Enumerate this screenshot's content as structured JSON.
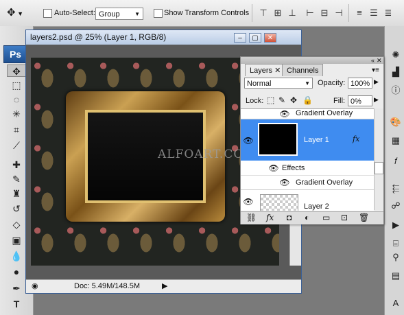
{
  "options_bar": {
    "auto_select_label": "Auto-Select:",
    "auto_select_value": "Group",
    "show_transform_label": "Show Transform Controls",
    "move_tool_icon": "move-icon"
  },
  "toolbox": {
    "logo": "Ps",
    "tools": [
      "move-icon",
      "marquee-icon",
      "lasso-icon",
      "magic-wand-icon",
      "crop-icon",
      "slice-icon",
      "healing-icon",
      "brush-icon",
      "clone-stamp-icon",
      "history-brush-icon",
      "eraser-icon",
      "gradient-icon",
      "blur-icon",
      "dodge-icon",
      "pen-icon",
      "type-icon"
    ]
  },
  "document": {
    "title": "layers2.psd @ 25% (Layer 1, RGB/8)",
    "status": "Doc: 5.49M/148.5M",
    "watermark": "ALFOART.COM"
  },
  "layers_panel": {
    "tabs": [
      "Layers",
      "Channels"
    ],
    "blend_mode": "Normal",
    "opacity_label": "Opacity:",
    "opacity_value": "100%",
    "lock_label": "Lock:",
    "fill_label": "Fill:",
    "fill_value": "0%",
    "rows": {
      "prev_gradient": "Gradient Overlay",
      "layer1": "Layer 1",
      "fx": "fx",
      "effects": "Effects",
      "gradient": "Gradient Overlay",
      "layer2": "Layer 2"
    },
    "selected_color": "#3f8cf0"
  }
}
